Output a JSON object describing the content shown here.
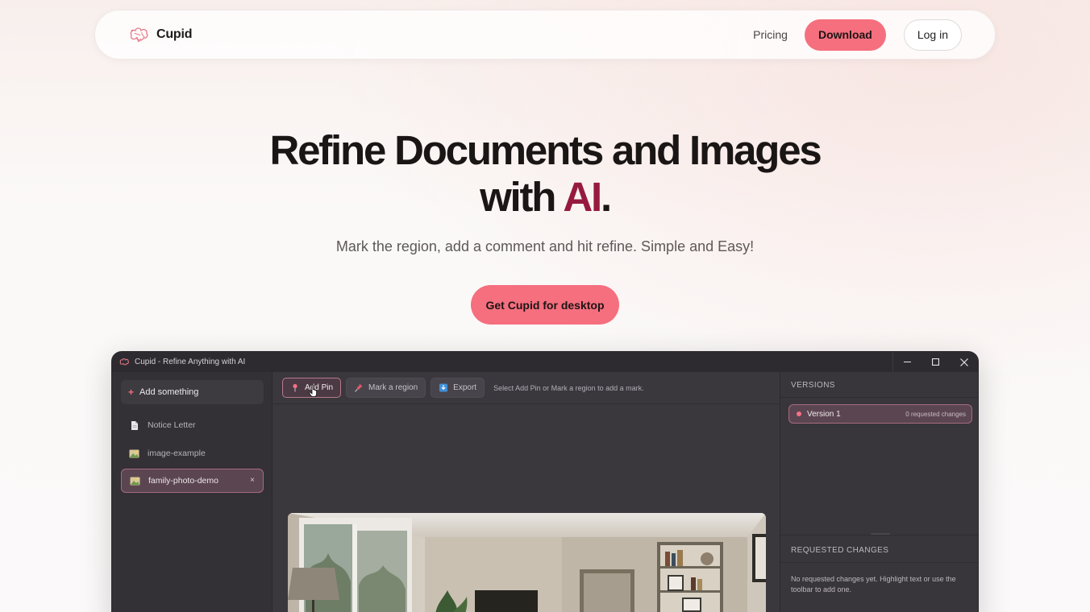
{
  "nav": {
    "brand": "Cupid",
    "links": [
      "Pricing"
    ],
    "download_label": "Download",
    "login_label": "Log in"
  },
  "hero": {
    "title_line1": "Refine Documents and Images",
    "title_line2_prefix": "with ",
    "title_line2_highlight": "AI",
    "title_line2_suffix": ".",
    "subtitle": "Mark the region, add a comment and hit refine. Simple and Easy!",
    "cta_label": "Get Cupid for desktop"
  },
  "app": {
    "window_title": "Cupid - Refine Anything with AI",
    "sidebar": {
      "add_label": "Add something",
      "items": [
        {
          "label": "Notice Letter",
          "icon": "document-icon"
        },
        {
          "label": "image-example",
          "icon": "image-icon"
        },
        {
          "label": "family-photo-demo",
          "icon": "image-icon",
          "active": true
        }
      ],
      "close_glyph": "×"
    },
    "toolbar": {
      "add_pin": "Add Pin",
      "mark_region": "Mark a region",
      "export": "Export",
      "hint": "Select Add Pin or Mark a region to add a mark."
    },
    "versions": {
      "heading": "VERSIONS",
      "items": [
        {
          "name": "Version 1",
          "count": "0 requested changes"
        }
      ]
    },
    "requested_changes": {
      "heading": "REQUESTED CHANGES",
      "empty": "No requested changes yet. Highlight text or use the toolbar to add one."
    }
  },
  "colors": {
    "accent": "#f56f7e",
    "ai_highlight": "#961a3e",
    "app_bg": "#3a373d"
  }
}
